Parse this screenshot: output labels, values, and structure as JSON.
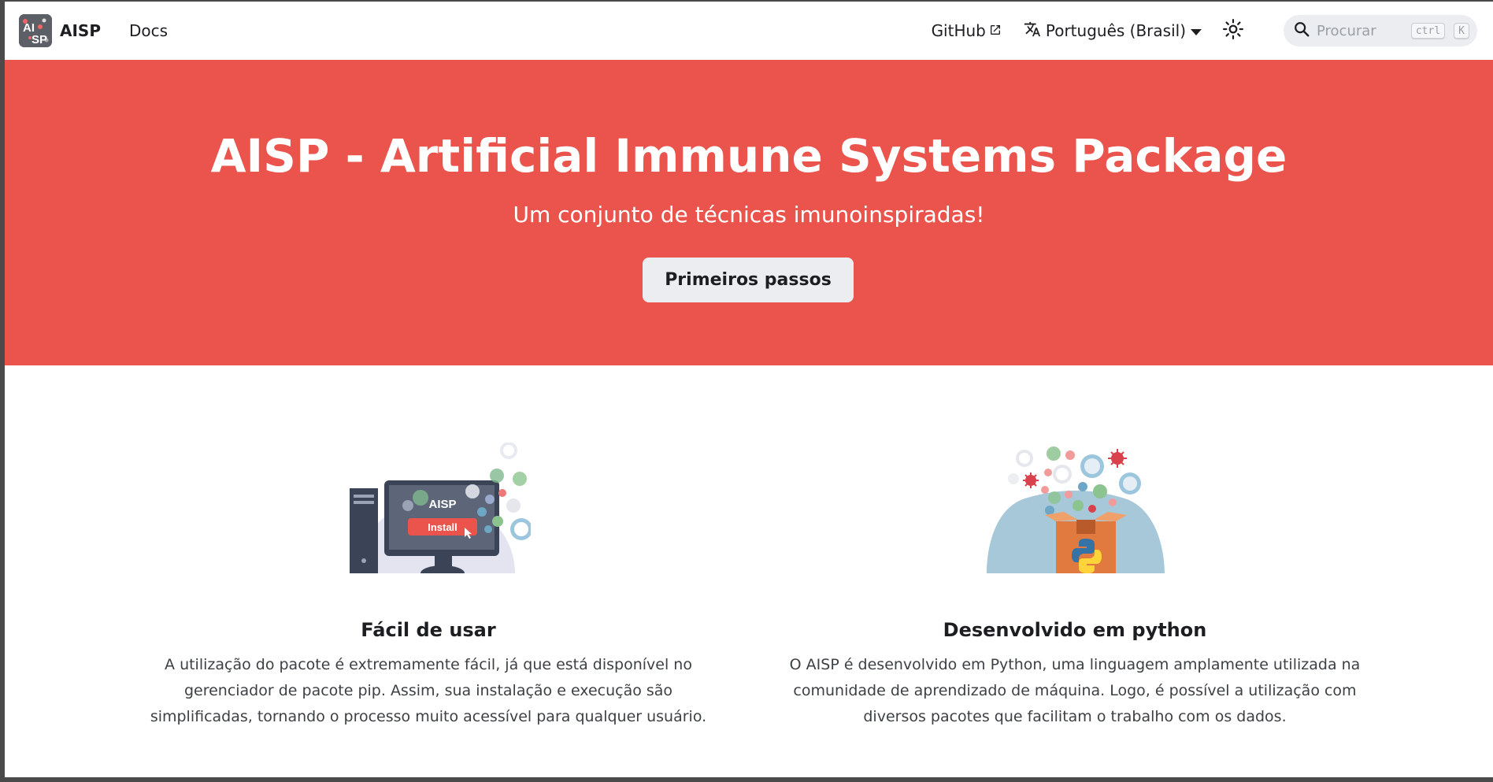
{
  "navbar": {
    "logo_alt": "AISP",
    "brand": "AISP",
    "docs": "Docs",
    "github": "GitHub",
    "language": "Português (Brasil)",
    "search_placeholder": "Procurar",
    "shortcut_ctrl": "ctrl",
    "shortcut_key": "K",
    "icons": [
      "external-link-icon",
      "translate-icon",
      "chevron-down-icon",
      "sun-icon",
      "search-icon"
    ]
  },
  "hero": {
    "title": "AISP - Artificial Immune Systems Package",
    "subtitle": "Um conjunto de técnicas imunoinspiradas!",
    "button": "Primeiros passos",
    "background_color": "#ea544c"
  },
  "features": [
    {
      "illustration_label": "AISP",
      "illustration_button": "Install",
      "title": "Fácil de usar",
      "text": "A utilização do pacote é extremamente fácil, já que está disponível no gerenciador de pacote pip. Assim, sua instalação e execução são simplificadas, tornando o processo muito acessível para qualquer usuário."
    },
    {
      "title": "Desenvolvido em python",
      "text": "O AISP é desenvolvido em Python, uma linguagem amplamente utilizada na comunidade de aprendizado de máquina. Logo, é possível a utilização com diversos pacotes que facilitam o trabalho com os dados."
    }
  ]
}
